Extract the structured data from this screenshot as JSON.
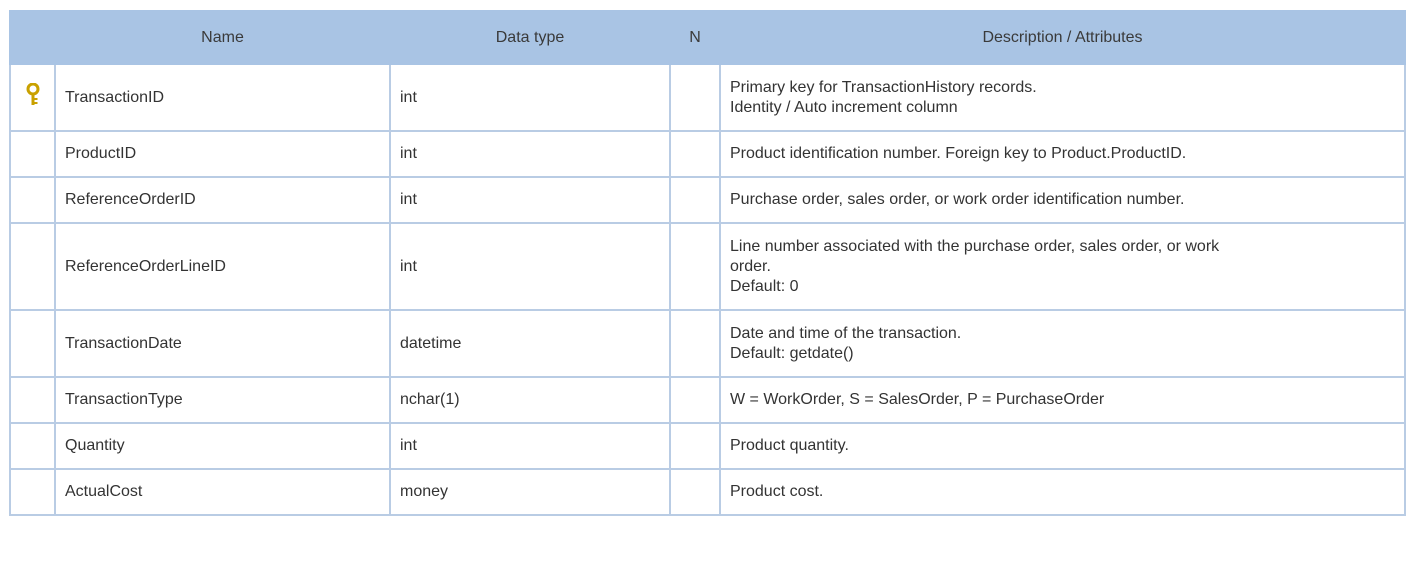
{
  "columns": {
    "name": "Name",
    "data_type": "Data type",
    "nullable": "N",
    "description": "Description / Attributes"
  },
  "colors": {
    "header_bg": "#a9c4e4",
    "grid_line": "#b9cce4",
    "key_icon": "#c9a100"
  },
  "rows": [
    {
      "key": true,
      "name": "TransactionID",
      "type": "int",
      "nullable": "",
      "desc1": "Primary key for TransactionHistory records.",
      "desc2": "Identity / Auto increment column",
      "desc3": ""
    },
    {
      "key": false,
      "name": "ProductID",
      "type": "int",
      "nullable": "",
      "desc1": "Product identification number. Foreign key to Product.ProductID.",
      "desc2": "",
      "desc3": ""
    },
    {
      "key": false,
      "name": "ReferenceOrderID",
      "type": "int",
      "nullable": "",
      "desc1": "Purchase order, sales order, or work order identification number.",
      "desc2": "",
      "desc3": ""
    },
    {
      "key": false,
      "name": "ReferenceOrderLineID",
      "type": "int",
      "nullable": "",
      "desc1": "Line number associated with the purchase order, sales order, or work",
      "desc2": "order.",
      "desc3": "Default: 0"
    },
    {
      "key": false,
      "name": "TransactionDate",
      "type": "datetime",
      "nullable": "",
      "desc1": "Date and time of the transaction.",
      "desc2": "Default: getdate()",
      "desc3": ""
    },
    {
      "key": false,
      "name": "TransactionType",
      "type": "nchar(1)",
      "nullable": "",
      "desc1": "W = WorkOrder, S = SalesOrder, P = PurchaseOrder",
      "desc2": "",
      "desc3": ""
    },
    {
      "key": false,
      "name": "Quantity",
      "type": "int",
      "nullable": "",
      "desc1": "Product quantity.",
      "desc2": "",
      "desc3": ""
    },
    {
      "key": false,
      "name": "ActualCost",
      "type": "money",
      "nullable": "",
      "desc1": "Product cost.",
      "desc2": "",
      "desc3": ""
    }
  ]
}
